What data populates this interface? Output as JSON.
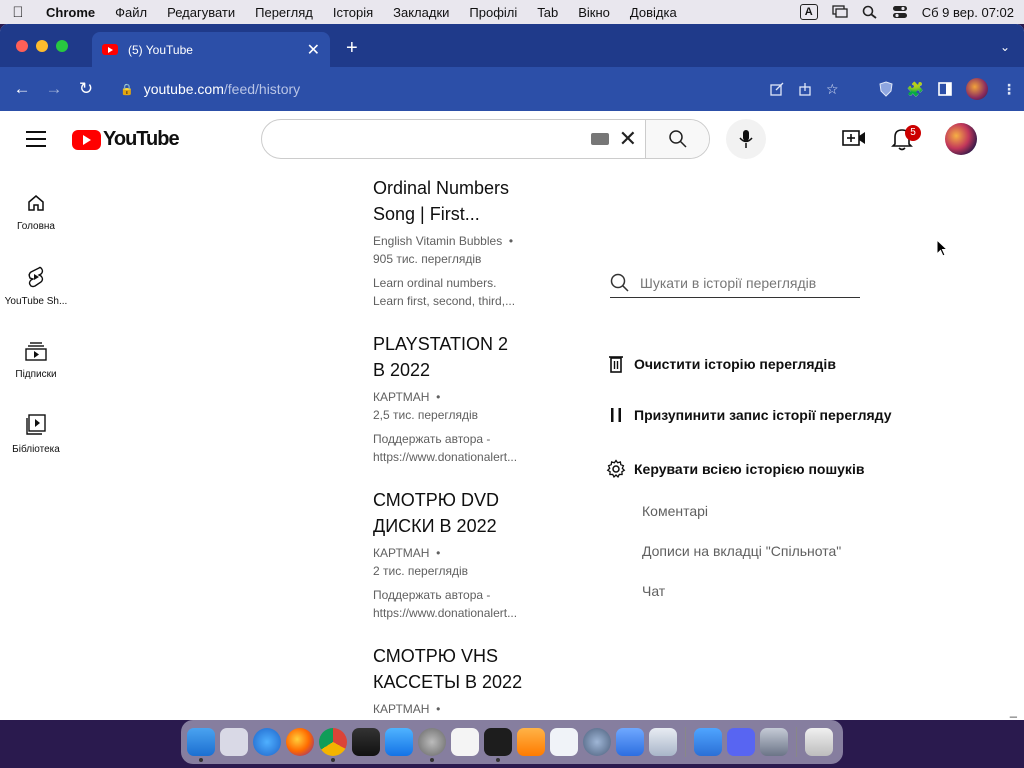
{
  "menubar": {
    "app": "Chrome",
    "items": [
      "Файл",
      "Редагувати",
      "Перегляд",
      "Історія",
      "Закладки",
      "Профілі",
      "Tab",
      "Вікно",
      "Довідка"
    ],
    "input_source": "A",
    "datetime": "Сб 9 вер.  07:02"
  },
  "browser": {
    "tab_title": "(5) YouTube",
    "url_host": "youtube.com",
    "url_path": "/feed/history"
  },
  "youtube": {
    "logo_text": "YouTube",
    "search_placeholder": "",
    "notification_count": "5",
    "guide": [
      {
        "label": "Головна",
        "icon": "home-icon"
      },
      {
        "label": "YouTube Sh...",
        "icon": "shorts-icon"
      },
      {
        "label": "Підписки",
        "icon": "subscriptions-icon"
      },
      {
        "label": "Бібліотека",
        "icon": "library-icon"
      }
    ],
    "videos": [
      {
        "title_line1": "Ordinal Numbers",
        "title_line2": "Song | First...",
        "channel": "English Vitamin Bubbles",
        "views": "905 тис. переглядів",
        "desc1": "Learn ordinal numbers.",
        "desc2": "Learn first, second, third,..."
      },
      {
        "title_line1": "PLAYSTATION 2",
        "title_line2": "В 2022",
        "channel": "КАРТМАН",
        "views": "2,5 тис. переглядів",
        "desc1": "Поддержать автора -",
        "desc2": "https://www.donationalert..."
      },
      {
        "title_line1": "СМОТРЮ DVD",
        "title_line2": "ДИСКИ В 2022",
        "channel": "КАРТМАН",
        "views": "2 тис. переглядів",
        "desc1": "Поддержать автора -",
        "desc2": "https://www.donationalert..."
      },
      {
        "title_line1": "СМОТРЮ VHS",
        "title_line2": "КАССЕТЫ В 2022",
        "channel": "КАРТМАН",
        "views": "",
        "desc1": "",
        "desc2": ""
      }
    ],
    "history_panel": {
      "search_placeholder": "Шукати в історії переглядів",
      "clear_label": "Очистити історію переглядів",
      "pause_label": "Призупинити запис історії перегляду",
      "manage_label": "Керувати всією історією пошуків",
      "sub_links": [
        "Коментарі",
        "Дописи на вкладці \"Спільнота\"",
        "Чат"
      ]
    }
  },
  "colors": {
    "tabstrip": "#1f3a8a",
    "toolbar": "#2c4fa8",
    "yt_red": "#ff0000",
    "badge": "#cc0000"
  },
  "dock": [
    "finder",
    "launchpad",
    "safari",
    "firefox",
    "chrome",
    "guitar",
    "app-store",
    "settings",
    "notes",
    "terminal",
    "vlc",
    "vscode",
    "proxyman",
    "mail",
    "preview",
    "weather",
    "discord",
    "screenshot",
    "trash"
  ]
}
